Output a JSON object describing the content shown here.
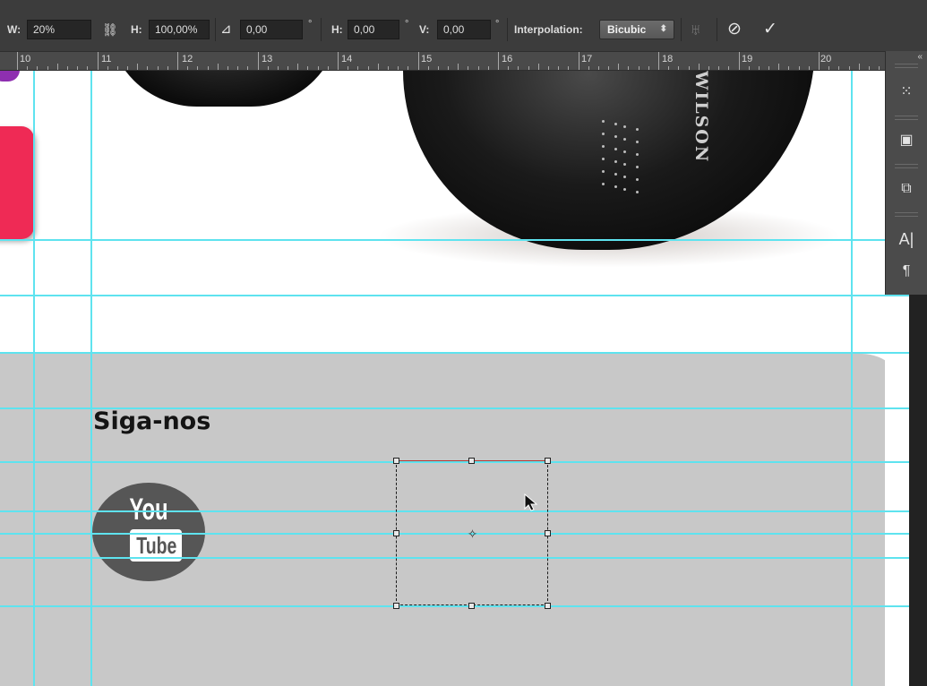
{
  "options_bar": {
    "w_label": "W:",
    "w_value": "20%",
    "link_icon": "chain-link-icon",
    "h_label": "H:",
    "h_value": "100,00%",
    "angle_icon": "angle-icon",
    "angle_value": "0,00",
    "degree_mark": "°",
    "skew_h_label": "H:",
    "skew_h_value": "0,00",
    "skew_v_label": "V:",
    "skew_v_value": "0,00",
    "interpolation_label": "Interpolation:",
    "interpolation_value": "Bicubic",
    "warp_icon": "warp-icon",
    "cancel_icon": "cancel-icon",
    "commit_icon": "checkmark-icon",
    "cancel_glyph": "⊘",
    "commit_glyph": "✓"
  },
  "ruler": {
    "labels": [
      "10",
      "11",
      "12",
      "13",
      "14",
      "15",
      "16",
      "17",
      "18",
      "19",
      "20"
    ]
  },
  "canvas": {
    "heading": "Siga-nos",
    "youtube_you": "You",
    "youtube_tube": "Tube",
    "brand_text": "WILSON",
    "guide_color": "#5ee3ef",
    "panel_color": "#c8c8c8"
  },
  "dock": {
    "collapse_glyph": "«",
    "buttons": [
      {
        "icon": "history-icon",
        "glyph": "⁙"
      },
      {
        "icon": "layer-comps-icon",
        "glyph": "▣"
      },
      {
        "icon": "clone-source-icon",
        "glyph": "⧉"
      },
      {
        "icon": "character-icon",
        "glyph": "A|"
      },
      {
        "icon": "paragraph-icon",
        "glyph": "¶"
      }
    ]
  }
}
